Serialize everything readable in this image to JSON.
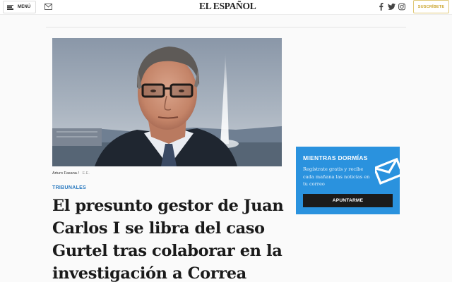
{
  "header": {
    "menu_label": "MENÚ",
    "logo_text": "EL ESPAÑOL",
    "subscribe_label": "SUSCRÍBETE",
    "icons": [
      "menu-icon",
      "mail-icon",
      "facebook-icon",
      "twitter-icon",
      "instagram-icon"
    ]
  },
  "article": {
    "photo_caption": {
      "name": "Arturo Fasana",
      "separator": "/",
      "credit": "E.E."
    },
    "section": "TRIBUNALES",
    "headline": "El presunto gestor de Juan Carlos I se libra del caso Gurtel tras colaborar en la investigación a Correa"
  },
  "newsletter": {
    "title": "MIENTRAS DORMÍAS",
    "text": "Regístrate gratis y recibe cada mañana las noticias en tu correo",
    "button_label": "APUNTARME",
    "background_color": "#2a92de"
  },
  "colors": {
    "accent_blue": "#2a7ac0",
    "subscribe_gold": "#c9a227"
  }
}
